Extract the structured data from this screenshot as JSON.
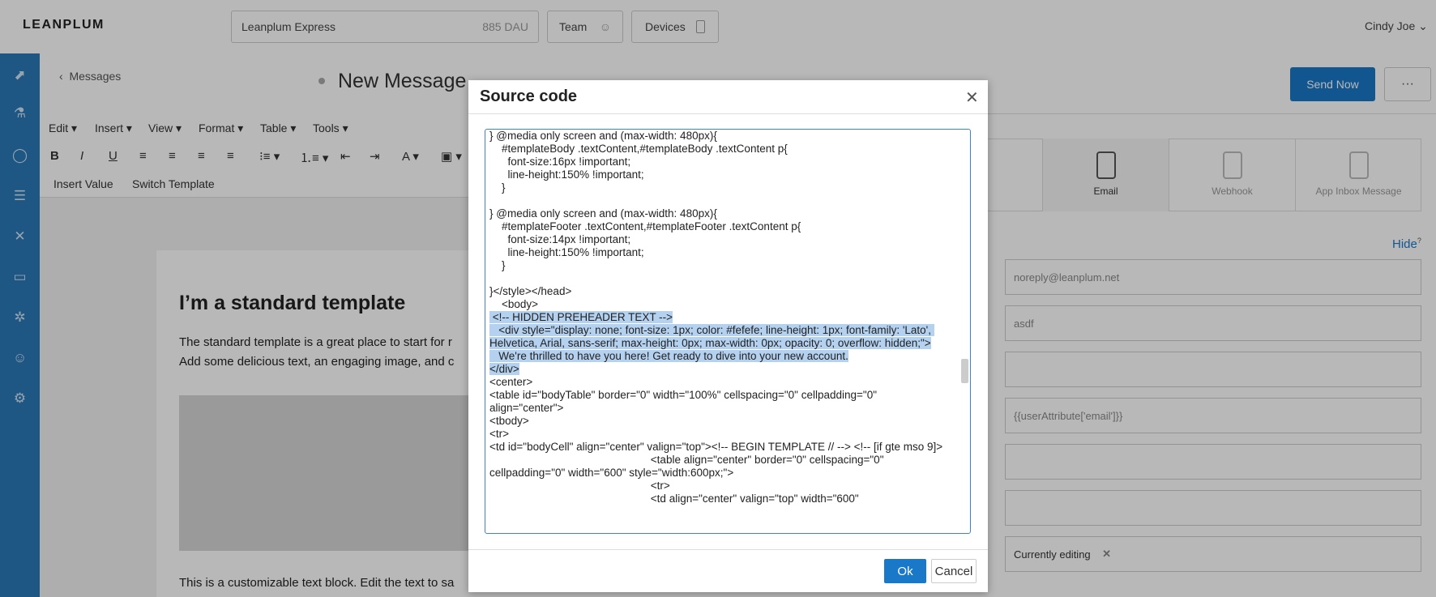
{
  "topbar": {
    "logo": "LEANPLUM",
    "app_name": "Leanplum Express",
    "dau": "885 DAU",
    "team_label": "Team",
    "devices_label": "Devices",
    "user": "Cindy Joe"
  },
  "editor": {
    "back_label": "Messages",
    "title": "New Message",
    "menu": [
      "Edit",
      "Insert",
      "View",
      "Format",
      "Table",
      "Tools"
    ],
    "insert_value": "Insert Value",
    "switch_template": "Switch Template",
    "content": {
      "heading": "I’m a standard template",
      "p1": "The standard template is a great place to start for r",
      "p2": "Add some delicious text, an engaging image, and c",
      "p3": "This is a customizable text block. Edit the text to sa"
    }
  },
  "right_panel": {
    "send_now": "Send Now",
    "types": [
      "Email",
      "Webhook",
      "App Inbox Message"
    ],
    "hide": "Hide",
    "fields": [
      "noreply@leanplum.net",
      "asdf",
      "",
      "{{userAttribute['email']}}",
      "",
      "",
      "Currently editing"
    ]
  },
  "dialog": {
    "title": "Source code",
    "code_before": "} @media only screen and (max-width: 480px){\n    #templateBody .textContent,#templateBody .textContent p{\n      font-size:16px !important;\n      line-height:150% !important;\n    }\n\n} @media only screen and (max-width: 480px){\n    #templateFooter .textContent,#templateFooter .textContent p{\n      font-size:14px !important;\n      line-height:150% !important;\n    }\n\n}</style></head>\n    <body>\n",
    "code_selected": " <!-- HIDDEN PREHEADER TEXT -->\n   <div style=\"display: none; font-size: 1px; color: #fefefe; line-height: 1px; font-family: 'Lato', Helvetica, Arial, sans-serif; max-height: 0px; max-width: 0px; opacity: 0; overflow: hidden;\">\n   We're thrilled to have you here! Get ready to dive into your new account.\n</div>",
    "code_after": "\n<center>\n<table id=\"bodyTable\" border=\"0\" width=\"100%\" cellspacing=\"0\" cellpadding=\"0\" align=\"center\">\n<tbody>\n<tr>\n<td id=\"bodyCell\" align=\"center\" valign=\"top\"><!-- BEGIN TEMPLATE // --> <!-- [if gte mso 9]>\n                                                     <table align=\"center\" border=\"0\" cellspacing=\"0\"\ncellpadding=\"0\" width=\"600\" style=\"width:600px;\">\n                                                     <tr>\n                                                     <td align=\"center\" valign=\"top\" width=\"600\"",
    "ok_label": "Ok",
    "cancel_label": "Cancel"
  }
}
